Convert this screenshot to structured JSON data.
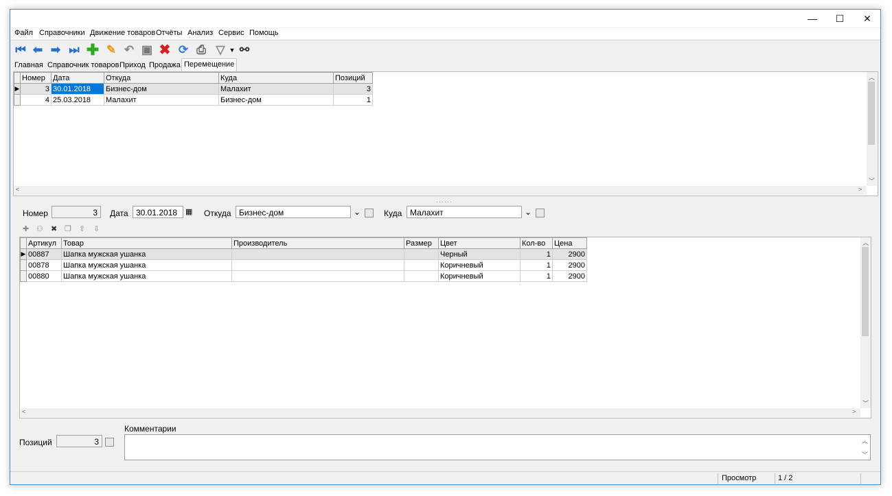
{
  "window": {
    "minimize": "—",
    "maximize": "☐",
    "close": "✕"
  },
  "menu": [
    "Файл",
    "Справочники",
    "Движение товаров",
    "Отчёты",
    "Анализ",
    "Сервис",
    "Помощь"
  ],
  "toolbar": {
    "icons": [
      "first-record-icon",
      "prev-record-icon",
      "next-record-icon",
      "last-record-icon",
      "add-icon",
      "edit-icon",
      "undo-icon",
      "save-icon",
      "delete-icon",
      "refresh-icon",
      "print-icon",
      "filter-icon",
      "search-binoculars-icon"
    ]
  },
  "tabs": [
    "Главная",
    "Справочник товаров",
    "Приход",
    "Продажа",
    "Перемещение"
  ],
  "transfers": {
    "columns": [
      "Номер",
      "Дата",
      "Откуда",
      "Куда",
      "Позиций"
    ],
    "rows": [
      {
        "num": "3",
        "date": "30.01.2018",
        "from": "Бизнес-дом",
        "to": "Малахит",
        "positions": "3"
      },
      {
        "num": "4",
        "date": "25.03.2018",
        "from": "Малахит",
        "to": "Бизнес-дом",
        "positions": "1"
      }
    ]
  },
  "form": {
    "number_label": "Номер",
    "number_value": "3",
    "date_label": "Дата",
    "date_value": "30.01.2018",
    "from_label": "Откуда",
    "from_value": "Бизнес-дом",
    "to_label": "Куда",
    "to_value": "Малахит"
  },
  "items": {
    "columns": [
      "Артикул",
      "Товар",
      "Производитель",
      "Размер",
      "Цвет",
      "Кол-во",
      "Цена"
    ],
    "rows": [
      {
        "sku": "00887",
        "name": "Шапка мужская ушанка",
        "maker": "",
        "size": "",
        "color": "Черный",
        "qty": "1",
        "price": "2900"
      },
      {
        "sku": "00878",
        "name": "Шапка мужская ушанка",
        "maker": "",
        "size": "",
        "color": "Коричневый",
        "qty": "1",
        "price": "2900"
      },
      {
        "sku": "00880",
        "name": "Шапка мужская ушанка",
        "maker": "",
        "size": "",
        "color": "Коричневый",
        "qty": "1",
        "price": "2900"
      }
    ]
  },
  "footer": {
    "positions_label": "Позиций",
    "positions_value": "3",
    "comments_label": "Комментарии"
  },
  "status": {
    "mode": "Просмотр",
    "page": "1 / 2"
  },
  "colors": {
    "selection": "#0078d7",
    "window_border": "#4a90c8"
  }
}
